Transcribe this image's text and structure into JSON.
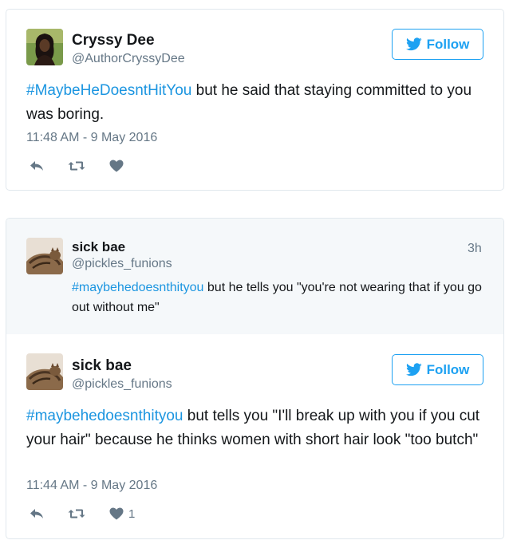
{
  "tweet1": {
    "name": "Cryssy Dee",
    "handle": "@AuthorCryssyDee",
    "follow_label": "Follow",
    "hashtag": "#MaybeHeDoesntHitYou",
    "text_rest": " but he said that staying committed to you was boring.",
    "timestamp": "11:48 AM - 9 May 2016",
    "icons": [
      "reply-icon",
      "retweet-icon",
      "heart-icon",
      "twitter-bird-icon"
    ]
  },
  "quoted": {
    "name": "sick bae",
    "handle": "@pickles_funions",
    "time_ago": "3h",
    "hashtag": "#maybehedoesnthityou",
    "text_rest": " but he tells you \"you're not wearing that if you go out without me\""
  },
  "tweet2": {
    "name": "sick bae",
    "handle": "@pickles_funions",
    "follow_label": "Follow",
    "hashtag": "#maybehedoesnthityou",
    "text_rest": " but tells you \"I'll break up with you if you cut your hair\" because he thinks women with short hair look \"too butch\"",
    "timestamp": "11:44 AM - 9 May 2016",
    "like_count": "1"
  },
  "colors": {
    "accent": "#1da1f2",
    "hashtag": "#1b95e0",
    "muted": "#657786",
    "quoted_bg": "#f5f8fa"
  }
}
